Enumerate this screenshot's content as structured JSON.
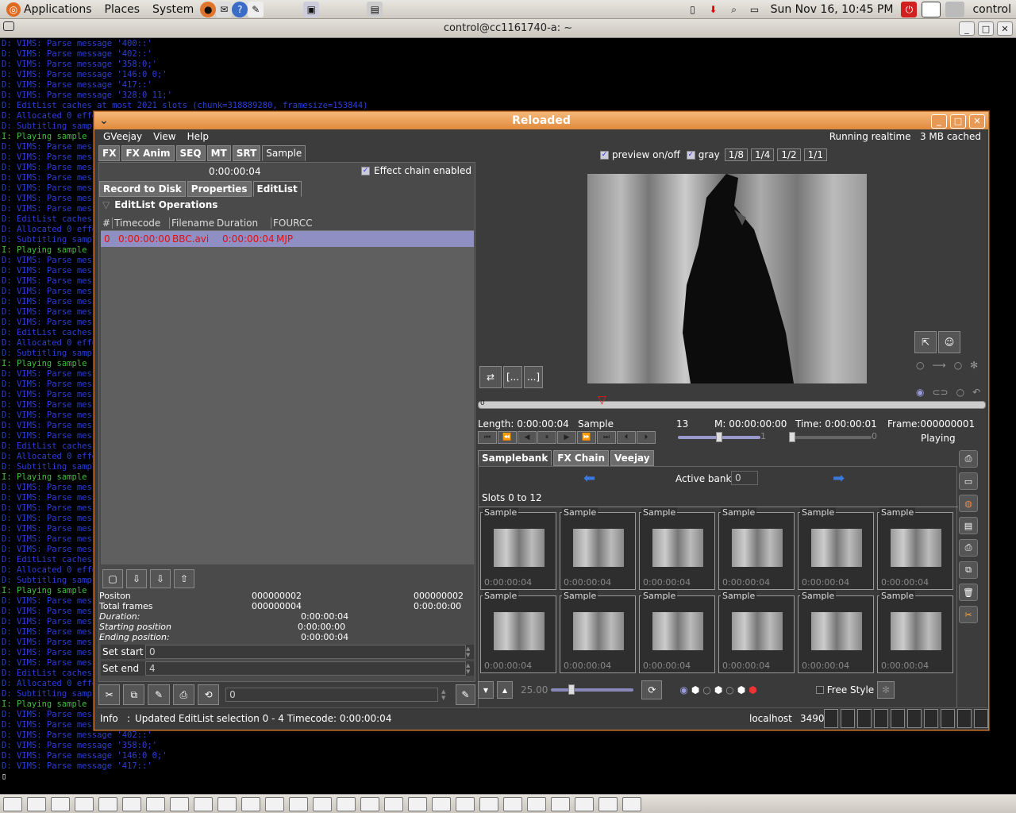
{
  "panel": {
    "applications": "Applications",
    "places": "Places",
    "system": "System",
    "clock": "Sun Nov 16, 10:45 PM",
    "user": "control"
  },
  "terminal": {
    "title": "control@cc1161740-a: ~",
    "lines": [
      "D: VIMS: Parse message '400::'",
      "D: VIMS: Parse message '402::'",
      "D: VIMS: Parse message '358:0;'",
      "D: VIMS: Parse message '146:0 0;'",
      "D: VIMS: Parse message '417::'",
      "D: VIMS: Parse message '328:0 11;'",
      "D: EditList caches at most 2021 slots (chunk=318889280, framesize=153844)",
      "D: Allocated 0 effects",
      "D: Subtitling sample 1",
      "I: Playing sample 1",
      "D: VIMS: Parse message",
      "D: VIMS: Parse message",
      "D: VIMS: Parse message",
      "D: VIMS: Parse message",
      "D: VIMS: Parse message",
      "D: VIMS: Parse message",
      "D: VIMS: Parse message",
      "D: EditList caches",
      "D: Allocated 0 effects",
      "D: Subtitling sample",
      "I: Playing sample 1",
      "D: VIMS: Parse message",
      "D: VIMS: Parse message",
      "D: VIMS: Parse message",
      "D: VIMS: Parse message",
      "D: VIMS: Parse message",
      "D: VIMS: Parse message",
      "D: VIMS: Parse message",
      "D: EditList caches",
      "D: Allocated 0 effects",
      "D: Subtitling sample",
      "I: Playing sample 1",
      "D: VIMS: Parse message",
      "D: VIMS: Parse message",
      "D: VIMS: Parse message",
      "D: VIMS: Parse message",
      "D: VIMS: Parse message",
      "D: VIMS: Parse message",
      "D: VIMS: Parse message",
      "D: EditList caches",
      "D: Allocated 0 effects",
      "D: Subtitling sample",
      "I: Playing sample 1",
      "D: VIMS: Parse message",
      "D: VIMS: Parse message",
      "D: VIMS: Parse message",
      "D: VIMS: Parse message",
      "D: VIMS: Parse message",
      "D: VIMS: Parse message",
      "D: VIMS: Parse message",
      "D: EditList caches",
      "D: Allocated 0 effects",
      "D: Subtitling sample",
      "I: Playing sample 1",
      "D: VIMS: Parse message",
      "D: VIMS: Parse message",
      "D: VIMS: Parse message",
      "D: VIMS: Parse message",
      "D: VIMS: Parse message",
      "D: VIMS: Parse message",
      "D: VIMS: Parse message",
      "D: EditList caches",
      "D: Allocated 0 effects",
      "D: Subtitling sample",
      "I: Playing sample 1",
      "D: VIMS: Parse message",
      "D: VIMS: Parse message",
      "D: VIMS: Parse message '402::'",
      "D: VIMS: Parse message '358:0;'",
      "D: VIMS: Parse message '146:0 0;'",
      "D: VIMS: Parse message '417::'"
    ]
  },
  "window": {
    "title": "Reloaded",
    "running": "Running realtime",
    "cached": "3 MB cached"
  },
  "menu": {
    "gveejay": "GVeejay",
    "view": "View",
    "help": "Help"
  },
  "tabs": [
    "FX",
    "FX Anim",
    "SEQ",
    "MT",
    "SRT",
    "Sample"
  ],
  "timecode": "0:00:00:04",
  "effect_chain": "Effect chain enabled",
  "subtabs": [
    "Record to Disk",
    "Properties",
    "EditList"
  ],
  "editlist": {
    "heading": "EditList Operations",
    "cols": [
      "#",
      "Timecode",
      "Filename",
      "Duration",
      "FOURCC"
    ],
    "row": [
      "0",
      "0:00:00:00",
      "BBC.avi",
      "0:00:00:04",
      "MJP"
    ]
  },
  "info": {
    "pos_label": "Positon",
    "pos_val": "000000002",
    "pos_val2": "000000002",
    "tf_label": "Total frames",
    "tf_val": "000000004",
    "tf_val2": "0:00:00:00",
    "dur_label": "Duration:",
    "dur_val": "0:00:00:04",
    "start_label": "Starting position",
    "start_val": "0:00:00:00",
    "end_label": "Ending position:",
    "end_val": "0:00:00:04"
  },
  "setstart": {
    "label": "Set start",
    "value": "0"
  },
  "setend": {
    "label": "Set end",
    "value": "4"
  },
  "spin_bottom": "0",
  "preview": {
    "toggle": "preview on/off",
    "gray": "gray",
    "scales": [
      "1/8",
      "1/4",
      "1/2",
      "1/1"
    ]
  },
  "player": {
    "length": "Length: 0:00:00:04",
    "sample": "Sample",
    "num": "13",
    "m": "M:  00:00:00:00",
    "time": "Time:  0:00:00:01",
    "frame": "Frame:000000001",
    "playing": "Playing",
    "speed": "1",
    "slow": "0",
    "tl_start": "0"
  },
  "bank": {
    "tabs": [
      "Samplebank",
      "FX Chain",
      "Veejay"
    ],
    "active_label": "Active bank:",
    "active_value": "0",
    "slots": "Slots 0 to 12",
    "sample_label": "Sample",
    "sample_tc": "0:00:00:04"
  },
  "bottom": {
    "fps": "25.00",
    "freestyle": "Free Style"
  },
  "statusbar": {
    "info": "Info",
    "msg": "Updated EditList selection 0 - 4 Timecode:  0:00:00:04",
    "host": "localhost",
    "port": "3490"
  }
}
